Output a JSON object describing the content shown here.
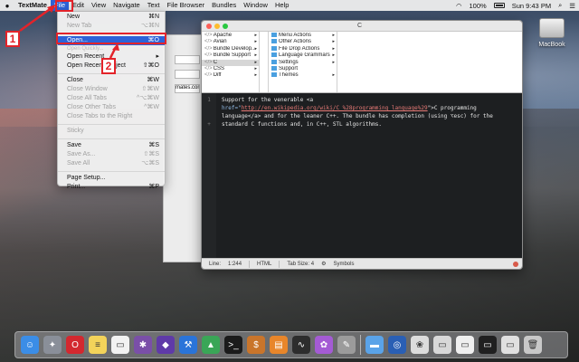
{
  "menubar": {
    "apple": "",
    "items": [
      "TextMate",
      "File",
      "Edit",
      "View",
      "Navigate",
      "Text",
      "File Browser",
      "Bundles",
      "Window",
      "Help"
    ],
    "right": {
      "wifi": "◠",
      "battery_pct": "100%",
      "clock": "Sun 9:43 PM"
    }
  },
  "file_menu": {
    "items": [
      {
        "label": "New",
        "shortcut": "⌘N",
        "disabled": false
      },
      {
        "label": "New Tab",
        "shortcut": "⌥⌘N",
        "disabled": true
      },
      {
        "sep": true
      },
      {
        "label": "Open...",
        "shortcut": "⌘O",
        "disabled": false,
        "highlighted": true
      },
      {
        "label": "Open Quickly...",
        "shortcut": "",
        "disabled": true,
        "partial": true
      },
      {
        "label": "Open Recent",
        "shortcut": "▸",
        "disabled": false
      },
      {
        "label": "Open Recent Project",
        "shortcut": "⇧⌘O",
        "disabled": false
      },
      {
        "sep": true
      },
      {
        "label": "Close",
        "shortcut": "⌘W",
        "disabled": false
      },
      {
        "label": "Close Window",
        "shortcut": "⇧⌘W",
        "disabled": true
      },
      {
        "label": "Close All Tabs",
        "shortcut": "^⌥⌘W",
        "disabled": true
      },
      {
        "label": "Close Other Tabs",
        "shortcut": "^⌘W",
        "disabled": true
      },
      {
        "label": "Close Tabs to the Right",
        "shortcut": "",
        "disabled": true
      },
      {
        "sep": true
      },
      {
        "label": "Sticky",
        "shortcut": "",
        "disabled": true
      },
      {
        "sep": true
      },
      {
        "label": "Save",
        "shortcut": "⌘S",
        "disabled": false
      },
      {
        "label": "Save As...",
        "shortcut": "⇧⌘S",
        "disabled": true
      },
      {
        "label": "Save All",
        "shortcut": "⌥⌘S",
        "disabled": true
      },
      {
        "sep": true
      },
      {
        "label": "Page Setup...",
        "shortcut": "",
        "disabled": false
      },
      {
        "label": "Print...",
        "shortcut": "⌘P",
        "disabled": false
      }
    ]
  },
  "backwin": {
    "field_text": "mates.com"
  },
  "editor": {
    "title": "C",
    "browser": {
      "col1": [
        {
          "label": "Apache",
          "arrow": "▸"
        },
        {
          "label": "Avian",
          "arrow": "▸"
        },
        {
          "label": "Bundle Develop...",
          "arrow": "▸"
        },
        {
          "label": "Bundle Support",
          "arrow": "▸"
        },
        {
          "label": "C",
          "arrow": "▸",
          "selected": true
        },
        {
          "label": "CSS",
          "arrow": "▸"
        },
        {
          "label": "Diff",
          "arrow": "▸"
        }
      ],
      "col2": [
        "Menu Actions",
        "Other Actions",
        "File Drop Actions",
        "Language Grammars",
        "Settings",
        "Support",
        "Themes"
      ],
      "col2_arrows": [
        "▸",
        "▸",
        "▸",
        "▸",
        "▸",
        "",
        "▸"
      ]
    },
    "gutter": [
      "1",
      "",
      "",
      "+"
    ],
    "code": {
      "line1": "Support for the venerable <a",
      "line2_pre": "href=\"",
      "line2_link": "http://en.wikipedia.org/wiki/C_%28programming_language%29",
      "line2_post": "\">C programming",
      "line3": "language</a> and for the leaner C++. The bundle has completion (using ⌥esc) for the",
      "line4": "standard C functions and, in C++, STL algorithms."
    },
    "status": {
      "line_label": "Line:",
      "position": "1:244",
      "grammar": "HTML",
      "tab_size": "Tab Size:  4",
      "symbols": "Symbols"
    }
  },
  "annotations": {
    "badge1": "1",
    "badge2": "2"
  },
  "desktop": {
    "drive_label": "MacBook"
  },
  "dock": {
    "icons": [
      {
        "name": "finder-icon",
        "color": "#3b8de6",
        "glyph": "☺"
      },
      {
        "name": "launchpad-icon",
        "color": "#8a8f99",
        "glyph": "✦"
      },
      {
        "name": "opera-icon",
        "color": "#d3282f",
        "glyph": "O"
      },
      {
        "name": "notes-icon",
        "color": "#f3d35a",
        "glyph": "≡"
      },
      {
        "name": "stickies-icon",
        "color": "#f2f2f2",
        "glyph": "▭"
      },
      {
        "name": "textmate-icon",
        "color": "#7a4fa8",
        "glyph": "✱"
      },
      {
        "name": "visual-studio-icon",
        "color": "#5f3aa8",
        "glyph": "◆"
      },
      {
        "name": "xcode-icon",
        "color": "#2a74d9",
        "glyph": "⚒"
      },
      {
        "name": "android-studio-icon",
        "color": "#3aa657",
        "glyph": "▲"
      },
      {
        "name": "terminal-icon",
        "color": "#1b1b1b",
        "glyph": ">_"
      },
      {
        "name": "dollar-app-icon",
        "color": "#c9752b",
        "glyph": "$"
      },
      {
        "name": "ibooks-icon",
        "color": "#e8862a",
        "glyph": "▤"
      },
      {
        "name": "activity-monitor-icon",
        "color": "#2d2d2d",
        "glyph": "∿"
      },
      {
        "name": "flower-app-icon",
        "color": "#a45bd4",
        "glyph": "✿"
      },
      {
        "name": "preview-icon",
        "color": "#9b9b9b",
        "glyph": "✎"
      },
      {
        "name": "folder-icon",
        "color": "#5aa3e8",
        "glyph": "▬"
      },
      {
        "name": "network-icon",
        "color": "#2a5fb4",
        "glyph": "◎"
      },
      {
        "name": "photos-icon",
        "color": "#dcdcdc",
        "glyph": "❀"
      },
      {
        "name": "window-thumb-icon",
        "color": "#d8d8d8",
        "glyph": "▭"
      },
      {
        "name": "window-thumb2-icon",
        "color": "#efefef",
        "glyph": "▭"
      },
      {
        "name": "window-thumb3-icon",
        "color": "#202020",
        "glyph": "▭"
      },
      {
        "name": "window-thumb4-icon",
        "color": "#e0e0e0",
        "glyph": "▭"
      },
      {
        "name": "trash-icon",
        "color": "#c8c8c8",
        "glyph": "🗑"
      }
    ]
  },
  "colors": {
    "accent": "#2c62d8",
    "annotation": "#e3232a"
  }
}
